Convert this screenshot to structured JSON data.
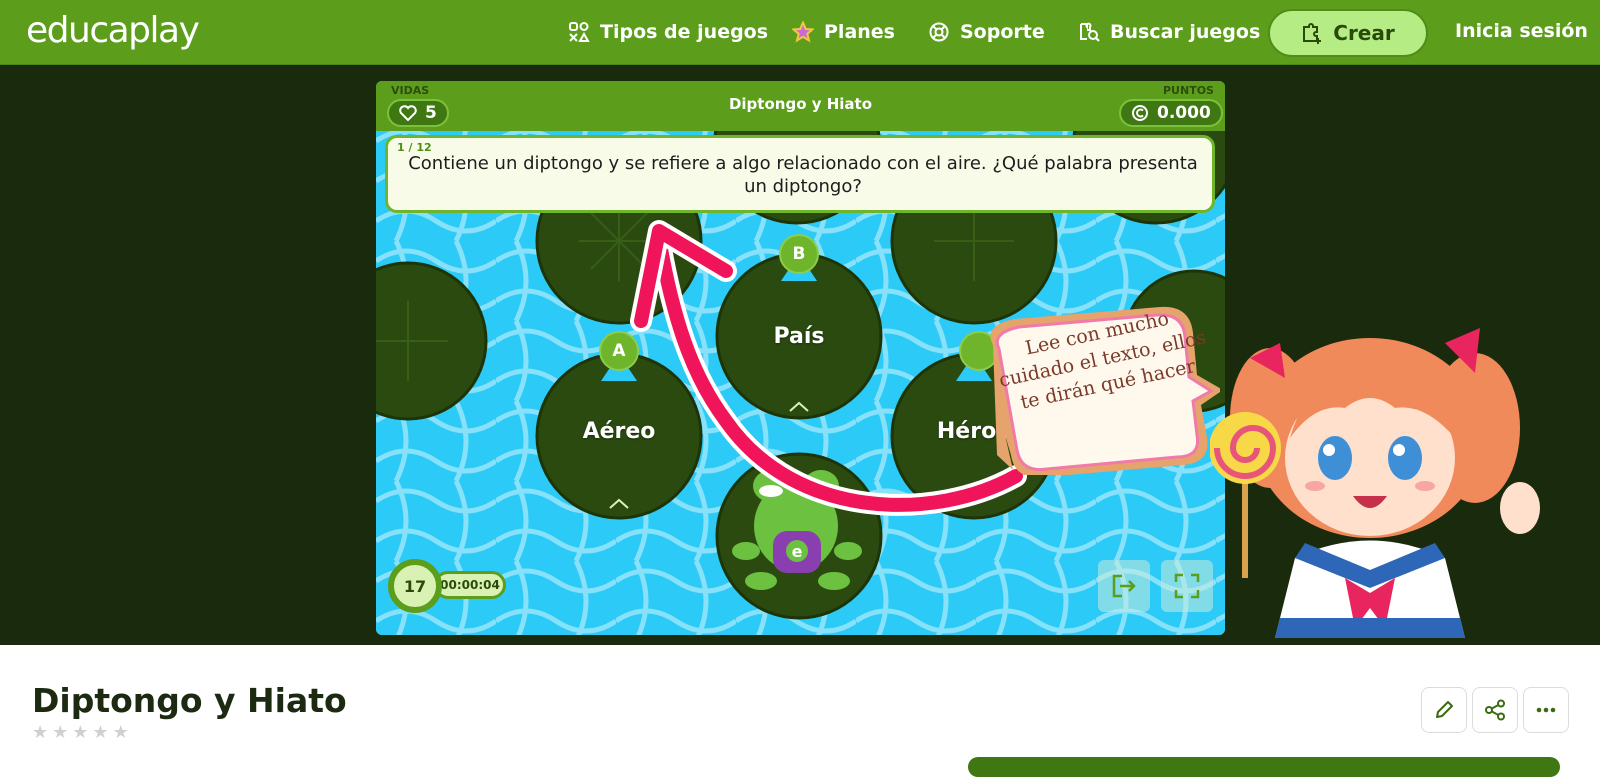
{
  "header": {
    "logo": "educaplay",
    "nav": [
      {
        "label": "Tipos de juegos",
        "icon": "game-types-icon"
      },
      {
        "label": "Planes",
        "icon": "star-icon"
      },
      {
        "label": "Soporte",
        "icon": "lifebuoy-icon"
      },
      {
        "label": "Buscar juegos",
        "icon": "search-games-icon"
      }
    ],
    "create_label": "Crear",
    "login_label": "Inicia sesión"
  },
  "game": {
    "title": "Diptongo y Hiato",
    "lives_label": "VIDAS",
    "lives": "5",
    "points_label": "PUNTOS",
    "points": "0.000",
    "question_counter": "1 / 12",
    "question": "Contiene un diptongo y se refiere a algo relacionado con el aire. ¿Qué palabra presenta un diptongo?",
    "options": [
      {
        "letter": "A",
        "text": "Aéreo"
      },
      {
        "letter": "B",
        "text": "País"
      },
      {
        "letter": "",
        "text": "Héroe"
      }
    ],
    "seconds_left": "17",
    "elapsed": "00:00:04",
    "frog_badge": "e",
    "hint": "Lee con mucho cuidado el texto, ellos te dirán qué hacer",
    "colors": {
      "header": "#5c9e1c",
      "water": "#2ccaf6",
      "lilypad": "#2a4a10",
      "arrow": "#f0145a"
    }
  },
  "activity": {
    "title": "Diptongo y Hiato",
    "rating": 0,
    "rating_max": 5
  }
}
